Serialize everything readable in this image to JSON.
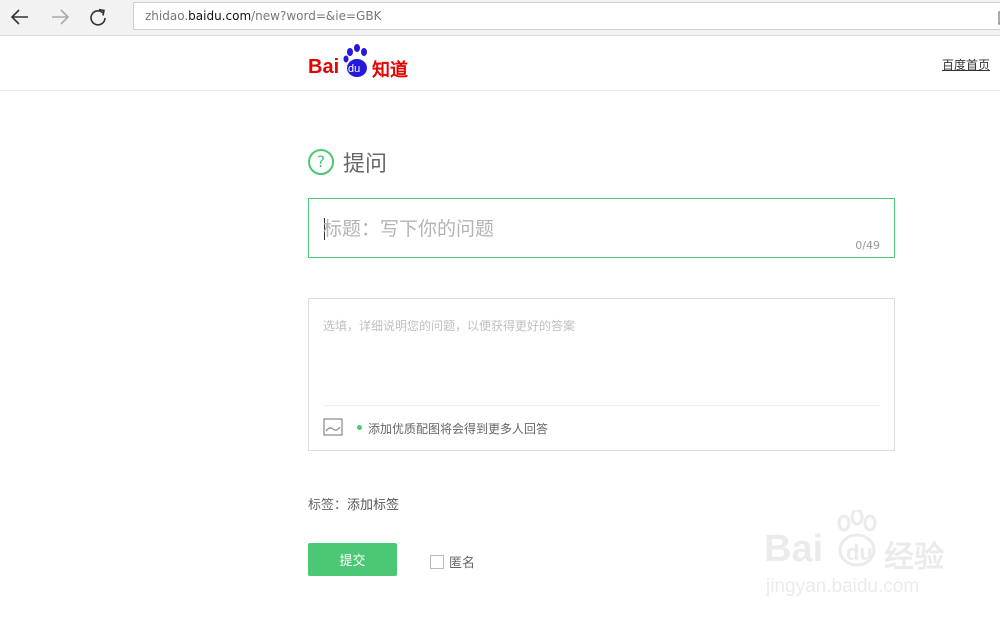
{
  "browser": {
    "url_prefix": "zhidao.",
    "url_domain": "baidu.com",
    "url_rest": "/new?word=&ie=GBK"
  },
  "header": {
    "logo_text": "Bai",
    "logo_paw_text": "du",
    "logo_suffix": "知道",
    "home_link": "百度首页"
  },
  "form": {
    "heading_icon": "?",
    "heading": "提问",
    "title_placeholder": "标题：写下你的问题",
    "title_counter": "0/49",
    "description_placeholder": "选填，详细说明您的问题，以便获得更好的答案",
    "image_hint": "添加优质配图将会得到更多人回答",
    "tags_label": "标签：",
    "tags_add": "添加标签",
    "submit": "提交",
    "anonymous": "匿名"
  },
  "watermark": {
    "brand": "Bai",
    "brand_paw": "du",
    "suffix": "经验",
    "url": "jingyan.baidu.com"
  },
  "colors": {
    "accent_green": "#4bc776",
    "logo_red": "#e10602",
    "logo_blue": "#2319dc"
  },
  "icons": {
    "back": "arrow-left-icon",
    "forward": "arrow-right-icon",
    "refresh": "refresh-icon",
    "reading_view": "book-icon",
    "question": "question-circle-icon",
    "image": "image-icon"
  }
}
